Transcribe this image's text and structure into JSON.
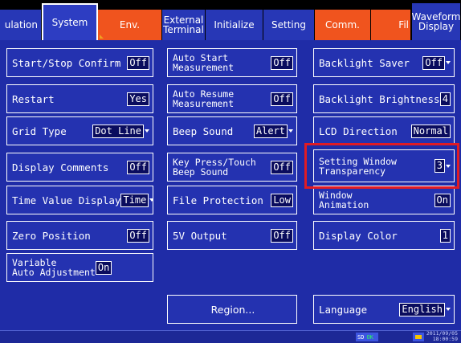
{
  "tabs": [
    {
      "label": "ulation"
    },
    {
      "label": "System"
    },
    {
      "label": "Env."
    },
    {
      "label_line1": "External",
      "label_line2": "Terminal"
    },
    {
      "label": "Initialize"
    },
    {
      "label": "Setting"
    },
    {
      "label": "Comm."
    },
    {
      "label": "Fil"
    },
    {
      "label_line1": "Waveform",
      "label_line2": "Display"
    }
  ],
  "col1": [
    {
      "label": "Start/Stop Confirm",
      "value": "Off"
    },
    {
      "label": "Restart",
      "value": "Yes"
    },
    {
      "label": "Grid Type",
      "value": "Dot Line"
    },
    {
      "label": "Display Comments",
      "value": "Off"
    },
    {
      "label": "Time Value Display",
      "value": "Time"
    },
    {
      "label": "Zero Position",
      "value": "Off"
    },
    {
      "label_line1": "Variable",
      "label_line2": "Auto Adjustment",
      "value": "On"
    }
  ],
  "col2": [
    {
      "label_line1": "Auto Start",
      "label_line2": "Measurement",
      "value": "Off"
    },
    {
      "label_line1": "Auto Resume",
      "label_line2": "Measurement",
      "value": "Off"
    },
    {
      "label": "Beep Sound",
      "value": "Alert"
    },
    {
      "label_line1": "Key Press/Touch",
      "label_line2": "Beep Sound",
      "value": "Off"
    },
    {
      "label": "File Protection",
      "value": "Low"
    },
    {
      "label": "5V Output",
      "value": "Off"
    },
    {
      "label": "Region..."
    }
  ],
  "col3": [
    {
      "label": "Backlight Saver",
      "value": "Off"
    },
    {
      "label": "Backlight Brightness",
      "value": "4"
    },
    {
      "label": "LCD Direction",
      "value": "Normal"
    },
    {
      "label_line1": "Setting Window",
      "label_line2": "Transparency",
      "value": "3"
    },
    {
      "label_line1": "Window",
      "label_line2": "Animation",
      "value": "On"
    },
    {
      "label": "Display Color",
      "value": "1"
    },
    {
      "label": "Language",
      "value": "English"
    }
  ],
  "status": {
    "sd": "SD",
    "sd_state": "OK",
    "date": "2011/09/05",
    "time": "18:00:59"
  }
}
